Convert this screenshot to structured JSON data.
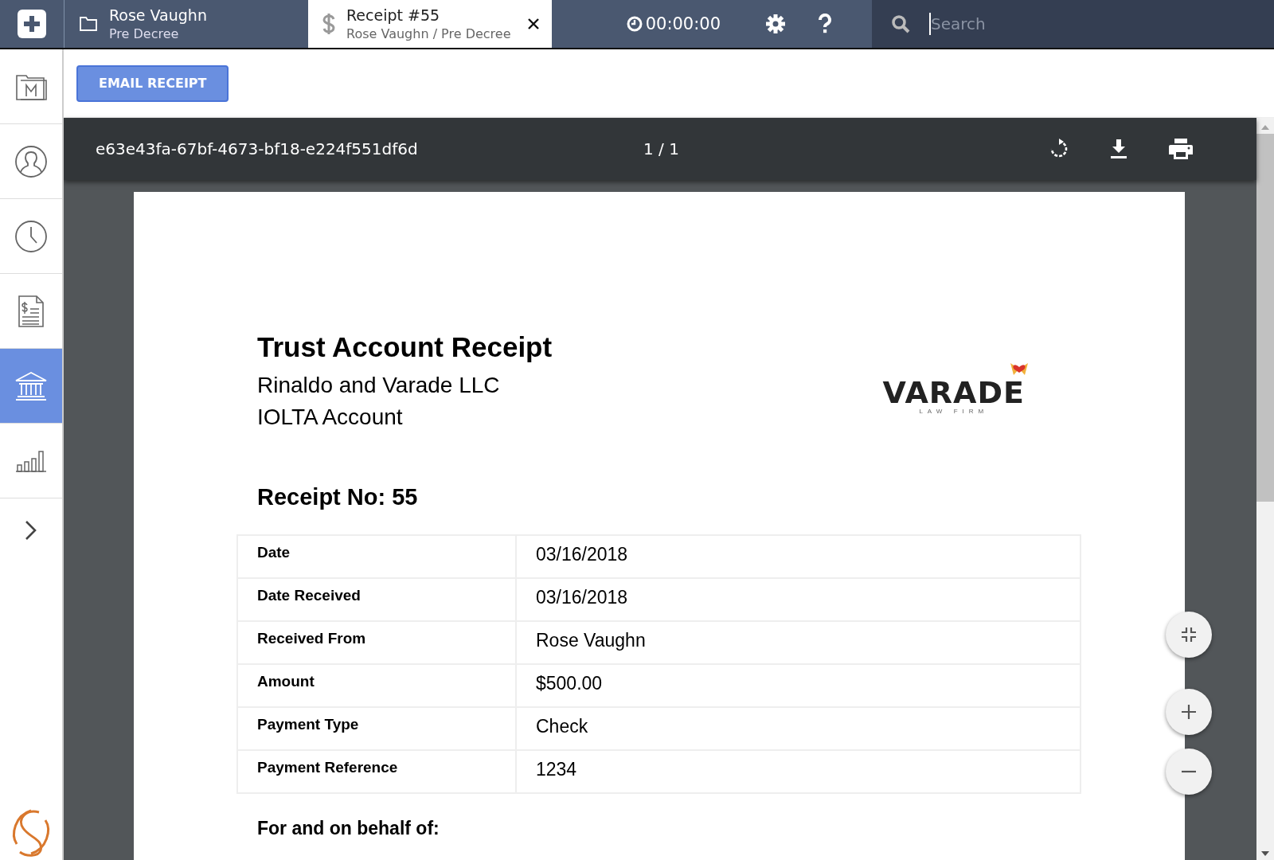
{
  "tabs": [
    {
      "title": "Rose Vaughn",
      "subtitle": "Pre Decree",
      "kind": "folder",
      "selected": false,
      "closable": false
    },
    {
      "title": "Receipt #55",
      "subtitle": "Rose Vaughn / Pre Decree",
      "kind": "dollar",
      "selected": true,
      "closable": true
    }
  ],
  "timer": "00:00:00",
  "search": {
    "placeholder": "Search"
  },
  "sidebar": {
    "items": [
      {
        "selected": false
      },
      {
        "selected": false
      },
      {
        "selected": false
      },
      {
        "selected": false
      },
      {
        "selected": true
      },
      {
        "selected": false
      },
      {
        "selected": false
      }
    ]
  },
  "actions": [
    "EMAIL RECEIPT"
  ],
  "viewer": {
    "document_id": "e63e43fa-67bf-4673-bf18-e224f551df6d",
    "page_indicator": "1 / 1"
  },
  "receipt": {
    "title": "Trust Account Receipt",
    "firm": "Rinaldo and Varade LLC",
    "account": "IOLTA Account",
    "logo": {
      "name": "VARADE",
      "tagline": "LAW FIRM"
    },
    "receipt_no": "Receipt No: 55",
    "rows": [
      {
        "label": "Date",
        "value": "03/16/2018"
      },
      {
        "label": "Date Received",
        "value": "03/16/2018"
      },
      {
        "label": "Received From",
        "value": "Rose Vaughn"
      },
      {
        "label": "Amount",
        "value": "$500.00"
      },
      {
        "label": "Payment Type",
        "value": "Check"
      },
      {
        "label": "Payment Reference",
        "value": "1234"
      }
    ],
    "footer": "For and on behalf of:"
  }
}
